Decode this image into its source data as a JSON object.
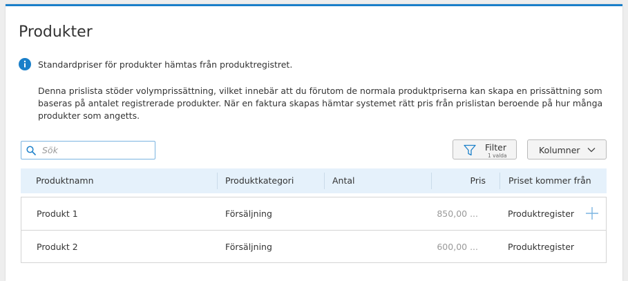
{
  "page": {
    "title": "Produkter",
    "info_text": "Standardpriser för produkter hämtas från produktregistret.",
    "description": "Denna prislista stöder volymprissättning, vilket innebär att du förutom de normala produktpriserna kan skapa en prissättning som baseras på antalet registrerade produkter. När en faktura skapas hämtar systemet rätt pris från prislistan beroende på hur många produkter som angetts."
  },
  "toolbar": {
    "search_placeholder": "Sök",
    "search_value": "",
    "filter_label": "Filter",
    "filter_sub": "1 valda",
    "columns_label": "Kolumner"
  },
  "table": {
    "headers": [
      "Produktnamn",
      "Produktkategori",
      "Antal",
      "Pris",
      "Priset kommer från"
    ],
    "rows": [
      {
        "name": "Produkt 1",
        "category": "Försäljning",
        "quantity": "",
        "price": "850,00 ...",
        "source": "Produktregister"
      },
      {
        "name": "Produkt 2",
        "category": "Försäljning",
        "quantity": "",
        "price": "600,00 ...",
        "source": "Produktregister"
      }
    ]
  },
  "icons": {
    "info": "info-icon",
    "search": "search-icon",
    "filter": "filter-icon",
    "columns_chevron": "chevron-down-icon",
    "row_add": "plus-icon"
  },
  "colors": {
    "accent": "#1a7fc9",
    "header_bg": "#e5f1fb",
    "muted_text": "#999999"
  }
}
